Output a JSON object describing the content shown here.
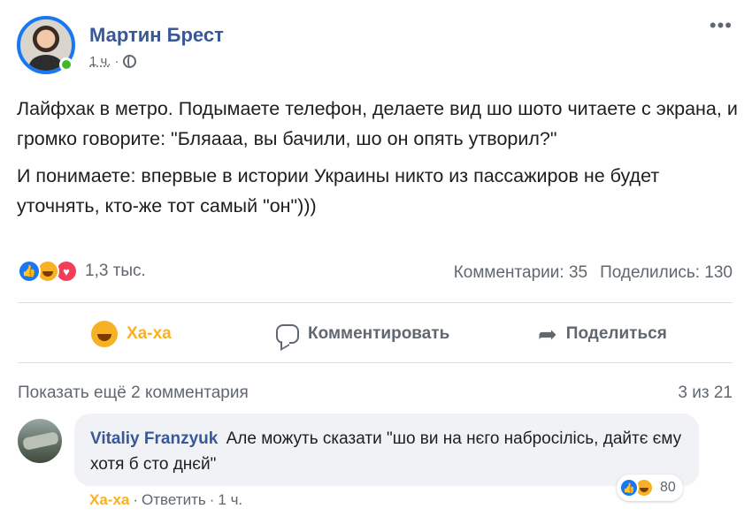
{
  "post": {
    "author": "Мартин Брест",
    "time": "1 ч.",
    "separator": "·",
    "more": "•••",
    "paragraphs": [
      "Лайфхак в метро. Подымаете телефон, делаете вид шо шото читаете с экрана, и громко говорите: \"Бляааа, вы бачили, шо он опять утворил?\"",
      "И понимаете: впервые в истории Украины никто из пассажиров не будет уточнять, кто-же тот самый \"он\")))"
    ],
    "reactions": {
      "icons": [
        "like-icon",
        "haha-icon",
        "love-icon"
      ],
      "count": "1,3 тыс."
    },
    "comments_count": "Комментарии: 35",
    "shares_count": "Поделились: 130"
  },
  "actions": {
    "react_label": "Ха-ха",
    "comment_label": "Комментировать",
    "share_label": "Поделиться"
  },
  "comments": {
    "show_more": "Показать ещё 2 комментария",
    "page": "3 из 21",
    "items": [
      {
        "author": "Vitaliy Franzyuk",
        "text": "Але можуть сказати \"шо ви на нєго набросілісь, дайтє єму хотя б сто днєй\"",
        "reaction_count": "80",
        "react_label": "Ха-ха",
        "reply_label": "Ответить",
        "time": "1 ч."
      }
    ]
  },
  "colors": {
    "link": "#385898",
    "muted": "#606770",
    "haha": "#f7b125",
    "like": "#1877f2",
    "love": "#f33e58",
    "online": "#42b72a"
  }
}
